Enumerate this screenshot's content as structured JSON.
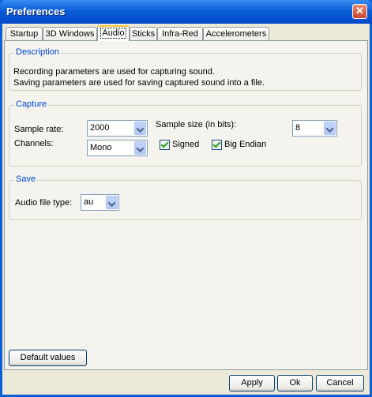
{
  "window": {
    "title": "Preferences"
  },
  "tabs": [
    {
      "label": "Startup"
    },
    {
      "label": "3D Windows"
    },
    {
      "label": "Audio"
    },
    {
      "label": "Sticks"
    },
    {
      "label": "Infra-Red"
    },
    {
      "label": "Accelerometers"
    }
  ],
  "active_tab": "Audio",
  "description": {
    "legend": "Description",
    "line1": "Recording parameters are used for capturing sound.",
    "line2": "Saving parameters are used for saving captured sound into a file."
  },
  "capture": {
    "legend": "Capture",
    "sample_rate_label": "Sample rate:",
    "sample_rate_value": "2000",
    "channels_label": "Channels:",
    "channels_value": "Mono",
    "sample_size_label": "Sample size (in bits):",
    "sample_size_value": "8",
    "signed_label": "Signed",
    "signed_checked": true,
    "big_endian_label": "Big Endian",
    "big_endian_checked": true
  },
  "save": {
    "legend": "Save",
    "file_type_label": "Audio file type:",
    "file_type_value": "au"
  },
  "buttons": {
    "default_values": "Default values",
    "apply": "Apply",
    "ok": "Ok",
    "cancel": "Cancel"
  },
  "colors": {
    "accent": "#0046D5",
    "titlebar": "#0A5ED7"
  }
}
